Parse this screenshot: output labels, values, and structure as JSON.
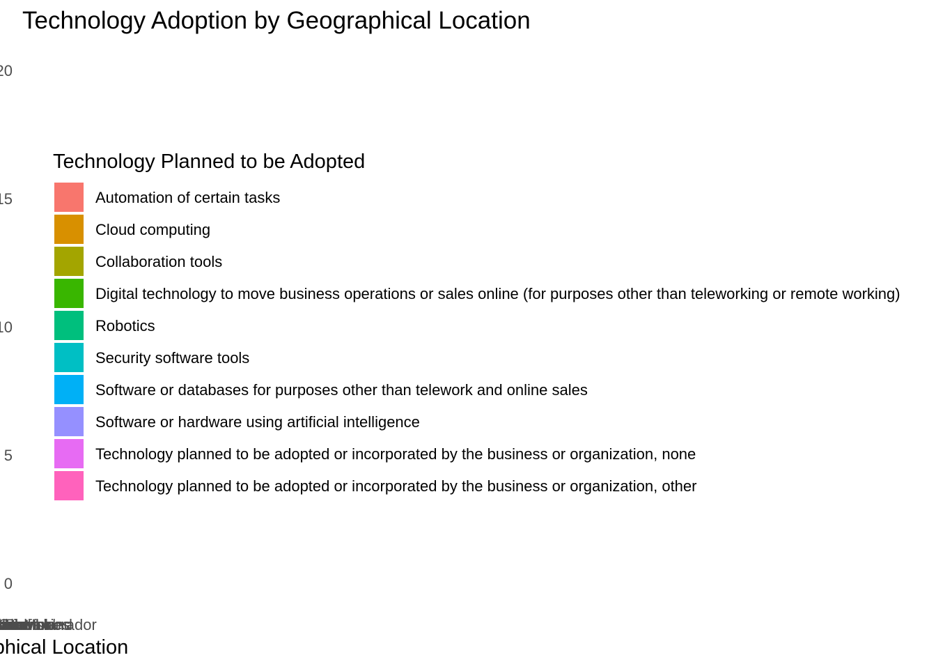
{
  "chart_data": {
    "type": "bar",
    "title": "Technology Adoption by Geographical Location",
    "xlabel": "Geographical Location",
    "ylabel": "",
    "ylim": [
      0,
      20
    ],
    "y_ticks": [
      "0",
      "5",
      "10",
      "15",
      "20"
    ],
    "x_tick_labels": [
      "Canada",
      "Newfoundland and Labrador",
      "Prince Edward Island",
      "Nova Scotia",
      "New Brunswick",
      "Quebec",
      "Ontario",
      "Manitoba",
      "Saskatchewan",
      "Alberta",
      "British Columbia",
      "Yukon",
      "Northwest Territories",
      "Nunavut"
    ],
    "grid": false,
    "legend": {
      "title": "Technology Planned to be Adopted",
      "position": "overlaid top-left",
      "entries": [
        {
          "label": "Automation of certain tasks",
          "color": "#F8766D"
        },
        {
          "label": "Cloud computing",
          "color": "#D89000"
        },
        {
          "label": "Collaboration tools",
          "color": "#A3A500"
        },
        {
          "label": "Digital technology to move business operations or sales online (for purposes other than teleworking or remote working)",
          "color": "#39B600"
        },
        {
          "label": "Robotics",
          "color": "#00BF7D"
        },
        {
          "label": "Security software tools",
          "color": "#00BFC4"
        },
        {
          "label": "Software or databases for purposes other than telework and online sales",
          "color": "#00B0F6"
        },
        {
          "label": "Software or hardware using artificial intelligence",
          "color": "#9590FF"
        },
        {
          "label": "Technology planned to be adopted or incorporated by the business or organization, none",
          "color": "#E76BF3"
        },
        {
          "label": "Technology planned to be adopted or incorporated by the business or organization, other",
          "color": "#FF62BC"
        }
      ]
    },
    "series": []
  }
}
